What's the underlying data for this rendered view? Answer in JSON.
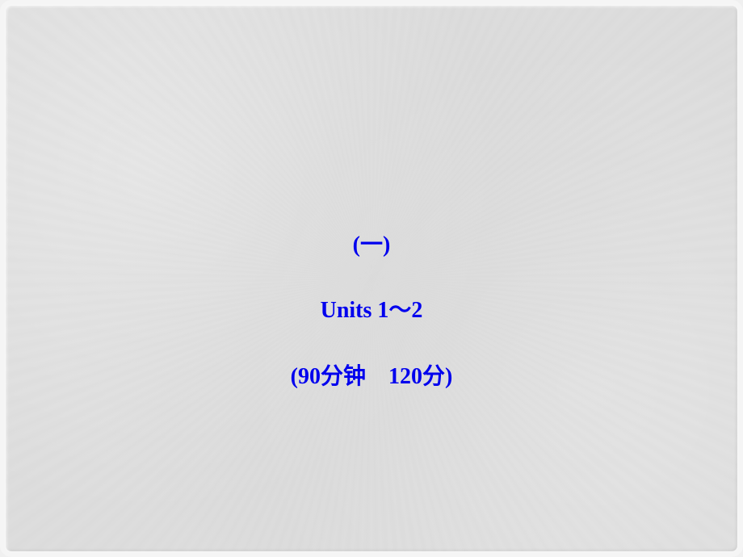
{
  "slide": {
    "line1": "(一)",
    "line2": "Units 1～2",
    "line3": "(90分钟　120分)"
  }
}
